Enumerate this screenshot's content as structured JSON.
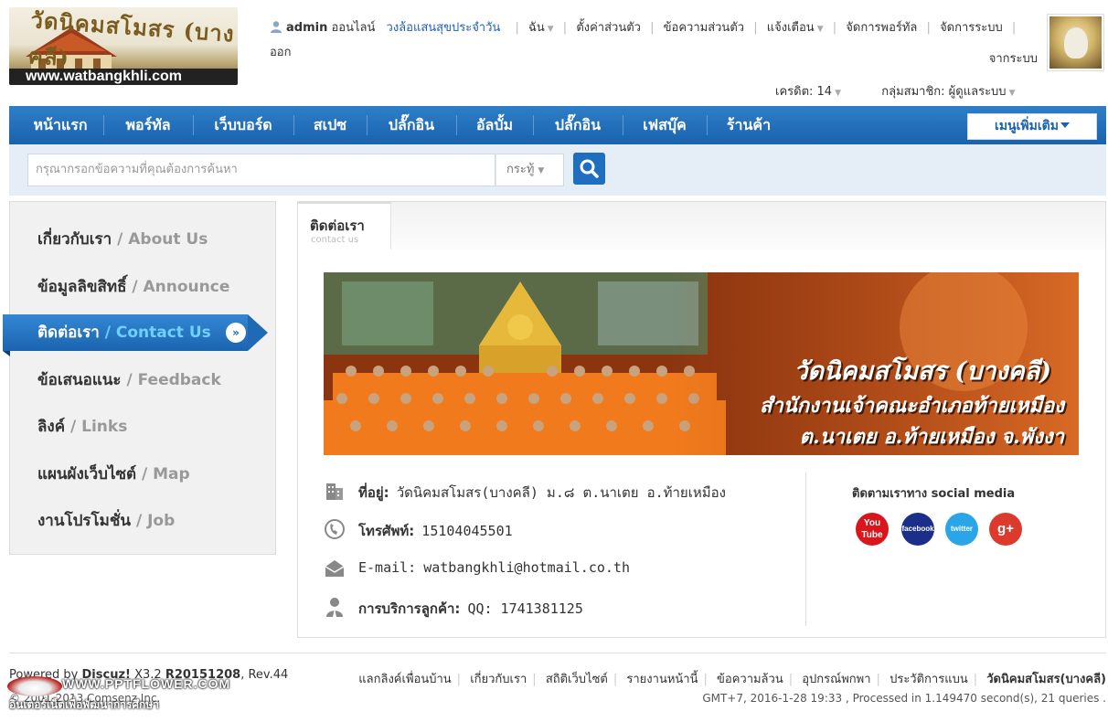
{
  "logo": {
    "text": "วัดนิคมสโมสร (บางคลี)",
    "url": "www.watbangkhli.com"
  },
  "userbar": {
    "username": "admin",
    "online": "ออนไลน์",
    "daily": "วงล้อแสนสุขประจำวัน",
    "links": [
      "ฉัน",
      "ตั้งค่าส่วนตัว",
      "ข้อความส่วนตัว",
      "แจ้งเตือน",
      "จัดการพอร์ทัล",
      "จัดการระบบ",
      "ออก"
    ],
    "logout_line2": "จากระบบ",
    "credit": "เครดิต: 14",
    "group": "กลุ่มสมาชิก: ผู้ดูแลระบบ"
  },
  "nav": {
    "items": [
      "หน้าแรก",
      "พอร์ทัล",
      "เว็บบอร์ด",
      "สเปซ",
      "ปลั๊กอิน",
      "อัลบั้ม",
      "ปลั๊กอิน",
      "เฟสบุ๊ค",
      "ร้านค้า"
    ],
    "more": "เมนูเพิ่มเติม"
  },
  "search": {
    "placeholder": "กรุณากรอกข้อความที่คุณต้องการค้นหา",
    "type": "กระทู้"
  },
  "sidebar": {
    "items": [
      {
        "th": "เกี่ยวกับเรา",
        "en": "/ About Us"
      },
      {
        "th": "ข้อมูลลิขสิทธิ์",
        "en": "/ Announce"
      },
      {
        "th": "ติดต่อเรา",
        "en": "/ Contact Us"
      },
      {
        "th": "ข้อเสนอแนะ",
        "en": "/ Feedback"
      },
      {
        "th": "ลิงค์",
        "en": "/ Links"
      },
      {
        "th": "แผนผังเว็บไซต์",
        "en": "/ Map"
      },
      {
        "th": "งานโปรโมชั่น",
        "en": "/ Job"
      }
    ]
  },
  "panel": {
    "tab_th": "ติดต่อเรา",
    "tab_en": "contact us",
    "banner": {
      "title": "วัดนิคมสโมสร (บางคลี)",
      "line1": "สำนักงานเจ้าคณะอำเภอท้ายเหมือง",
      "line2": "ต.นาเตย อ.ท้ายเหมือง จ.พังงา"
    },
    "contact": {
      "address_label": "ที่อยู่:",
      "address_value": "วัดนิคมสโมสร(บางคลี) ม.๘ ต.นาเตย อ.ท้ายเหมือง",
      "phone_label": "โทรศัพท์:",
      "phone_value": "15104045501",
      "email_label": "E-mail:",
      "email_value": "watbangkhli@hotmail.co.th",
      "service_label": "การบริการลูกค้า:",
      "service_value": "QQ: 1741381125"
    },
    "social": {
      "title": "ติดตามเราทาง social media",
      "icons": [
        "You Tube",
        "facebook",
        "twitter",
        "g+"
      ]
    }
  },
  "footer": {
    "powered": "Powered by",
    "brand": "Discuz!",
    "version": "X3.2",
    "release": "R20151208",
    "rev": ", Rev.44",
    "links": [
      "แลกลิงค์เพื่อนบ้าน",
      "เกี่ยวกับเรา",
      "สถิติเว็บไซต์",
      "รายงานหน้านี้",
      "ข้อความล้วน",
      "อุปกรณ์พกพา",
      "ประวัติการแบน"
    ],
    "site_name": "วัดนิคมสโมสร(บางคลี)",
    "copyright": "© 2001-2013 Comsenz Inc.",
    "stats": "GMT+7, 2016-1-28 19:33 , Processed in 1.149470 second(s), 21 queries .",
    "watermark_url": "WWW.PPTFLOWER.COM",
    "watermark_sub": "อินเตอร์เน็ตเพื่อพัฒนาการศึกษา"
  },
  "colors": {
    "nav": "#1a62ad",
    "accent": "#1e6fc0",
    "link": "#1f5fbf"
  }
}
